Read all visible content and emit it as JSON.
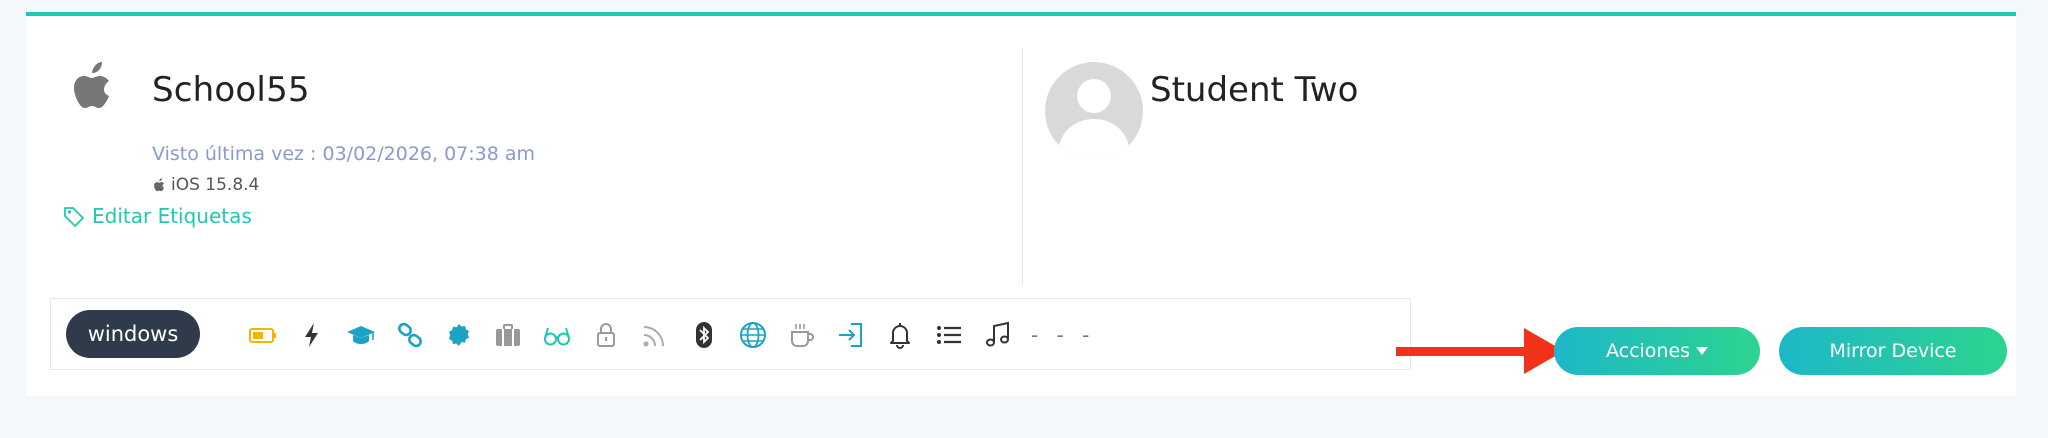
{
  "device": {
    "name": "School55",
    "last_seen": "Visto última vez : 03/02/2026, 07:38 am",
    "os_version": "iOS 15.8.4",
    "edit_tags_label": "Editar Etiquetas"
  },
  "student": {
    "name": "Student Two"
  },
  "toolbar": {
    "os_label": "windows",
    "status_icons": [
      "battery-icon",
      "lightning-icon",
      "graduation-cap-icon",
      "link-icon",
      "badge-icon",
      "briefcase-icon",
      "glasses-icon",
      "lock-icon",
      "rss-icon",
      "bluetooth-icon",
      "globe-icon",
      "coffee-icon",
      "sign-in-icon",
      "bell-icon",
      "list-icon",
      "music-icon"
    ],
    "trailing_text": "- - -"
  },
  "actions": {
    "actions_label": "Acciones",
    "mirror_label": "Mirror Device"
  },
  "colors": {
    "accent": "#1fc8b4",
    "pill_dark": "#2f3b4b",
    "arrow": "#f2311a",
    "battery": "#f5b400",
    "icon_blue": "#1aa3c4"
  }
}
